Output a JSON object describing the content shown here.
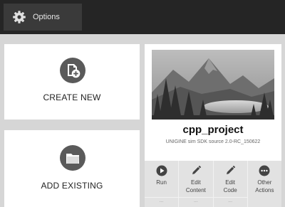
{
  "topbar": {
    "options_label": "Options",
    "options_icon": "gear-icon"
  },
  "cards": {
    "create": {
      "title": "CREATE NEW",
      "icon": "new-file-plus-icon"
    },
    "add": {
      "title": "ADD EXISTING",
      "icon": "folder-icon"
    }
  },
  "project": {
    "name": "cpp_project",
    "subtitle": "UNIGINE sim SDK source 2.0-RC_150622",
    "actions": [
      {
        "label_line1": "Run",
        "label_line2": "",
        "icon": "play-icon",
        "dots": "..."
      },
      {
        "label_line1": "Edit",
        "label_line2": "Content",
        "icon": "pencil-icon",
        "dots": "..."
      },
      {
        "label_line1": "Edit",
        "label_line2": "Code",
        "icon": "pencil-icon",
        "dots": "..."
      },
      {
        "label_line1": "Other",
        "label_line2": "Actions",
        "icon": "more-dots-icon",
        "dots": ""
      }
    ]
  },
  "colors": {
    "topbar": "#252525",
    "button": "#3a3a3a",
    "background": "#d6d6d6",
    "icon_circle": "#5a5a5a"
  }
}
